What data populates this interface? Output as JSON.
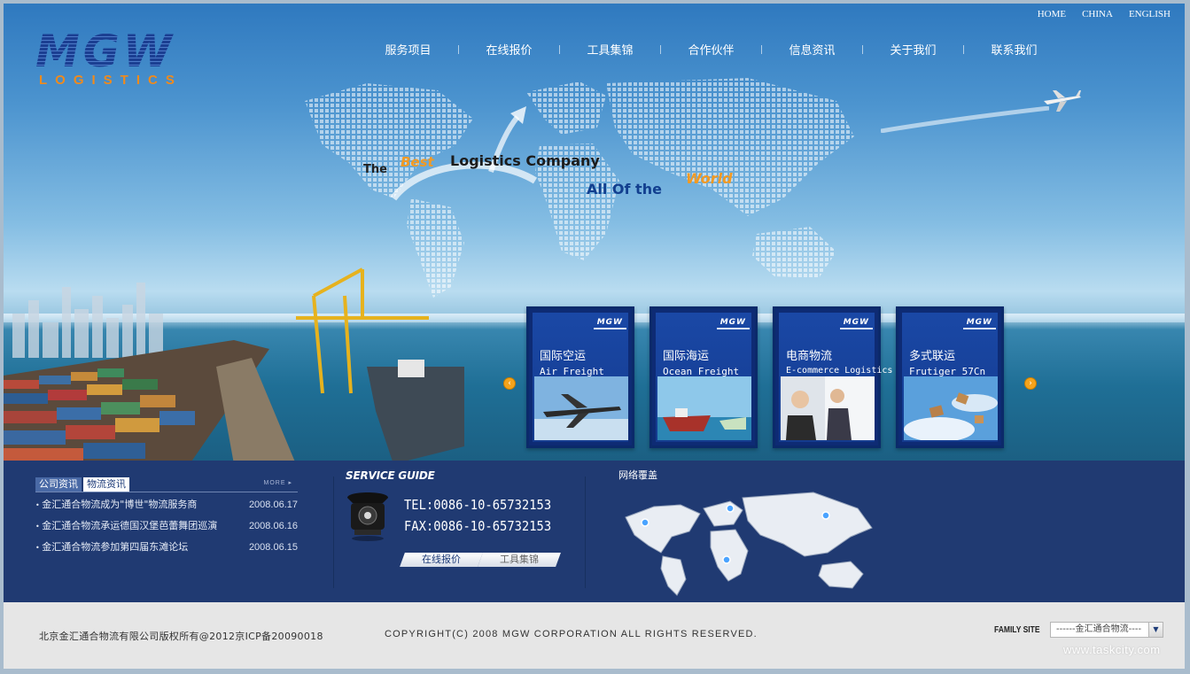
{
  "brand": {
    "logo_main": "MGW",
    "logo_sub": "LOGISTICS"
  },
  "top_nav": [
    "HOME",
    "CHINA",
    "ENGLISH"
  ],
  "main_nav": [
    "服务项目",
    "在线报价",
    "工具集锦",
    "合作伙伴",
    "信息资讯",
    "关于我们",
    "联系我们"
  ],
  "slogan": {
    "the": "The",
    "best": "Best",
    "logistics_company": "Logistics Company",
    "all_of_the": "All Of the",
    "world": "World"
  },
  "services": [
    {
      "cn": "国际空运",
      "en": "Air Freight",
      "logo": "MGW",
      "photo": "airplane-photo"
    },
    {
      "cn": "国际海运",
      "en": "Ocean Freight",
      "logo": "MGW",
      "photo": "ship-photo"
    },
    {
      "cn": "电商物流",
      "en": "E-commerce Logistics",
      "logo": "MGW",
      "photo": "office-photo"
    },
    {
      "cn": "多式联运",
      "en": "Frutiger 57Cn",
      "logo": "MGW",
      "photo": "boxes-sky-photo"
    }
  ],
  "news": {
    "tabs": [
      "公司资讯",
      "物流资讯"
    ],
    "more": "MORE",
    "items": [
      {
        "title": "金汇通合物流成为\"博世\"物流服务商",
        "date": "2008.06.17"
      },
      {
        "title": "金汇通合物流承运德国汉堡芭蕾舞团巡演",
        "date": "2008.06.16"
      },
      {
        "title": "金汇通合物流参加第四届东滩论坛",
        "date": "2008.06.15"
      }
    ]
  },
  "service_guide": {
    "title": "SERVICE GUIDE",
    "tel": "TEL:0086-10-65732153",
    "fax": "FAX:0086-10-65732153",
    "buttons": [
      "在线报价",
      "工具集锦"
    ]
  },
  "network": {
    "title": "网络覆盖"
  },
  "footer": {
    "copyright_cn": "北京金汇通合物流有限公司版权所有@2012京ICP备20090018",
    "copyright_en": "COPYRIGHT(C) 2008 MGW CORPORATION ALL RIGHTS RESERVED.",
    "family_label": "FAMILY SITE",
    "family_selected": "------金汇通合物流----",
    "watermark": "www.taskcity.com"
  },
  "colors": {
    "accent_orange": "#f39a22",
    "nav_blue": "#123f8f",
    "bar_bg": "#203a72"
  }
}
